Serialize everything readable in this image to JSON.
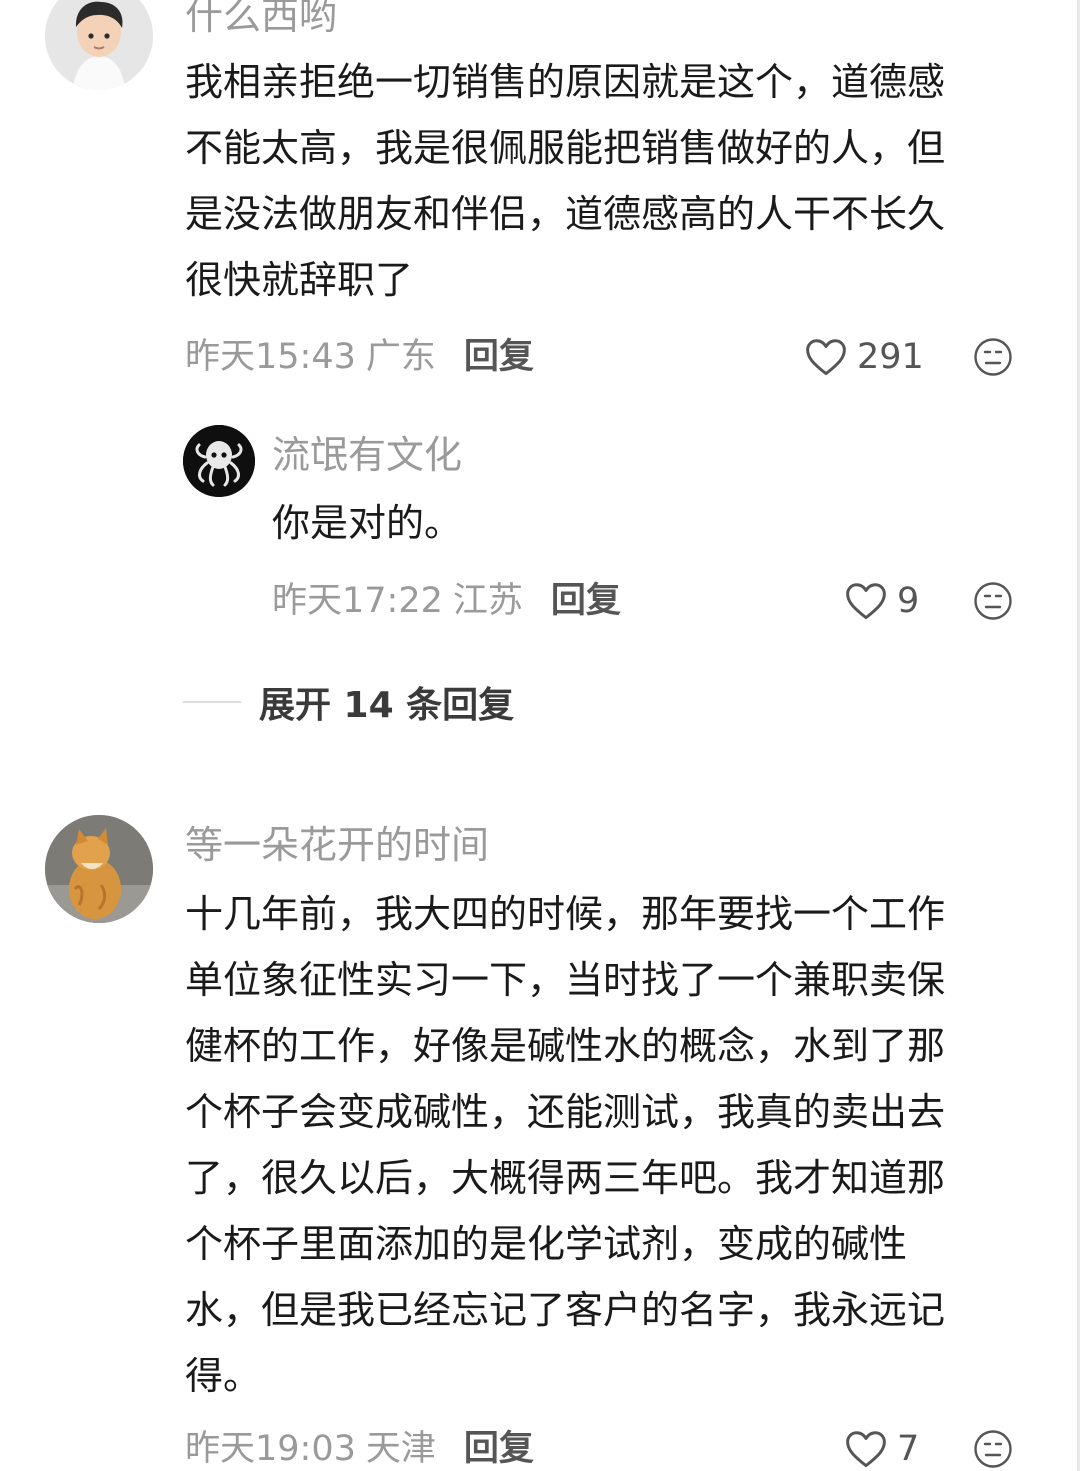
{
  "comments": [
    {
      "username": "什么西哟",
      "lines": [
        "我相亲拒绝一切销售的原因就是这个，道德感",
        "不能太高，我是很佩服能把销售做好的人，但",
        "是没法做朋友和伴侣，道德感高的人干不长久",
        "很快就辞职了"
      ],
      "time": "昨天15:43",
      "location": "广东",
      "reply_label": "回复",
      "likes": "291",
      "avatar_icon": "person-avatar"
    },
    {
      "username": "流氓有文化",
      "lines": [
        "你是对的。"
      ],
      "time": "昨天17:22",
      "location": "江苏",
      "reply_label": "回复",
      "likes": "9",
      "avatar_icon": "octopus-avatar"
    },
    {
      "username": "等一朵花开的时间",
      "lines": [
        "十几年前，我大四的时候，那年要找一个工作",
        "单位象征性实习一下，当时找了一个兼职卖保",
        "健杯的工作，好像是碱性水的概念，水到了那",
        "个杯子会变成碱性，还能测试，我真的卖出去",
        "了，很久以后，大概得两三年吧。我才知道那",
        "个杯子里面添加的是化学试剂，变成的碱性",
        "水，但是我已经忘记了客户的名字，我永远记",
        "得。"
      ],
      "time": "昨天19:03",
      "location": "天津",
      "reply_label": "回复",
      "likes": "7",
      "avatar_icon": "cat-avatar"
    }
  ],
  "expand_replies": "展开 14 条回复",
  "icons": {
    "like": "heart-outline-icon",
    "emoji": "meh-face-icon"
  },
  "colors": {
    "text": "#1a1a1a",
    "muted": "#9a9a9a",
    "reply": "#555555"
  }
}
